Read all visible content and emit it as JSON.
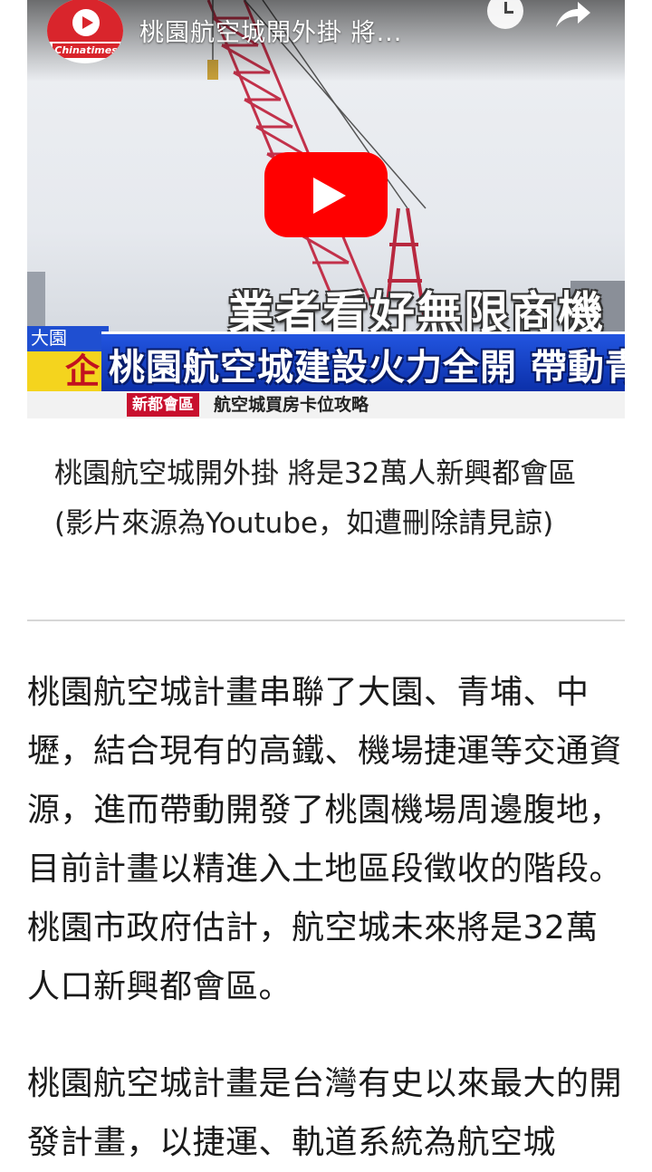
{
  "video": {
    "channel_logo_text": "Chinatimes",
    "title": "桃園航空城開外掛 將...",
    "overlay_caption": "業者看好無限商機",
    "tag_top": "大園",
    "tag_main": "企",
    "headline": "桃園航空城建設火力全開 帶動青埔房市",
    "strip_tag": "新都會區",
    "strip_text": "航空城買房卡位攻略",
    "icons": {
      "play": "play-icon",
      "watch_later": "clock-icon",
      "share": "share-icon"
    },
    "colors": {
      "play_button": "#ff0000",
      "headline_bar": "#1f4fd1",
      "strip_tag": "#c8102e"
    }
  },
  "caption": "桃園航空城開外掛 將是32萬人新興都會區 (影片來源為Youtube，如遭刪除請見諒)",
  "article": {
    "paragraphs": [
      "桃園航空城計畫串聯了大園、青埔、中壢，結合現有的高鐵、機場捷運等交通資源，進而帶動開發了桃園機場周邊腹地，目前計畫以精進入土地區段徵收的階段。桃園市政府估計，航空城未來將是32萬人口新興都會區。",
      "桃園航空城計畫是台灣有史以來最大的開發計畫，以捷運、軌道系統為航空城"
    ]
  }
}
